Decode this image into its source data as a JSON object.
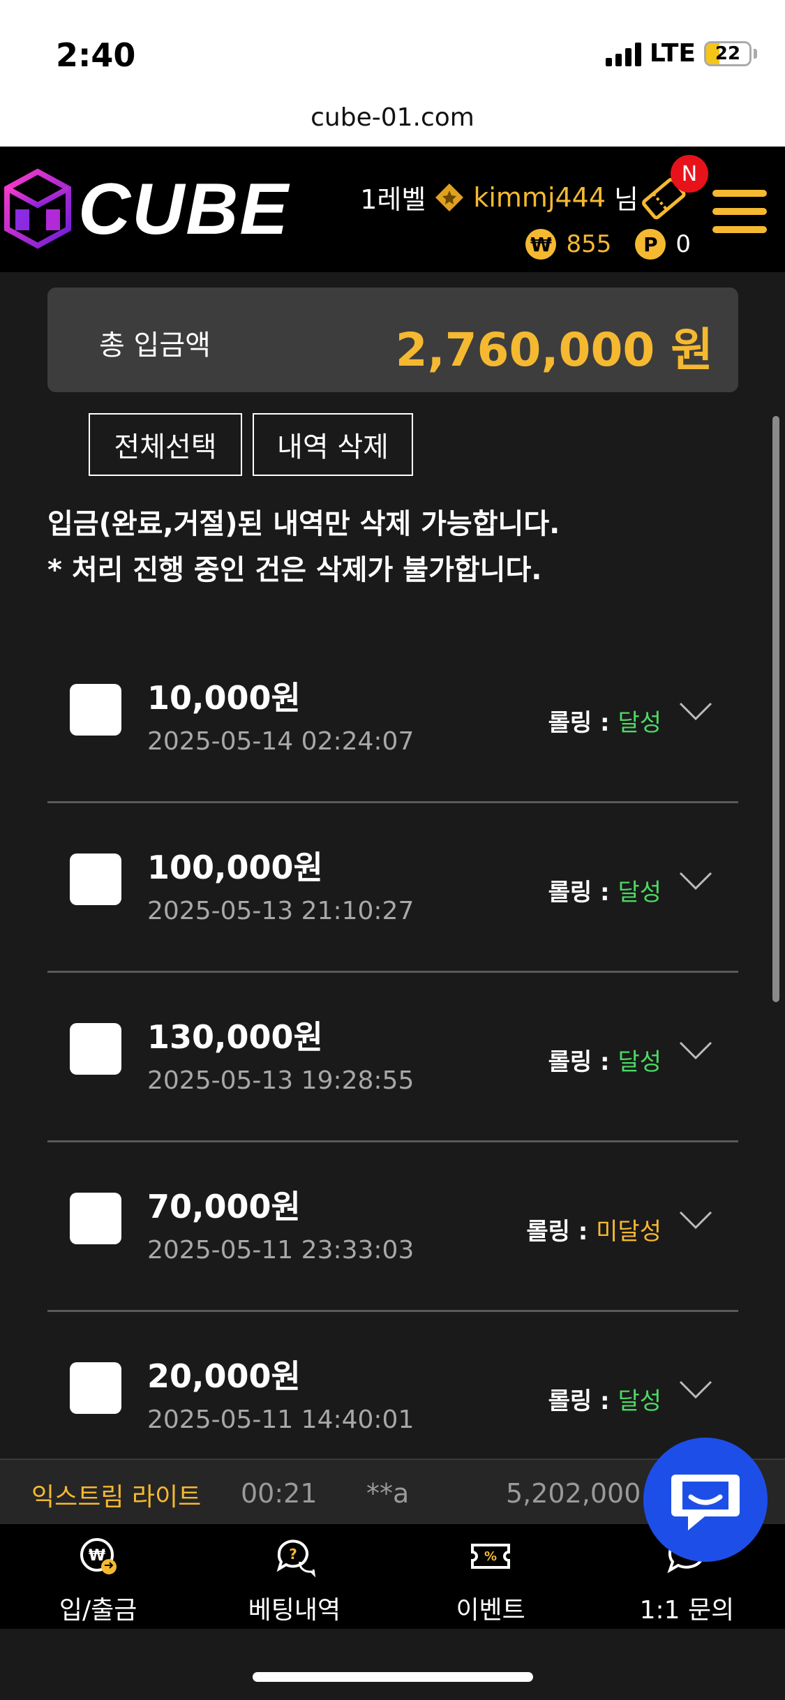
{
  "status_bar": {
    "time": "2:40",
    "network": "LTE",
    "battery": "22"
  },
  "browser": {
    "url": "cube-01.com"
  },
  "header": {
    "logo_text": "CUBE",
    "level": "1레벨",
    "username": "kimmj444",
    "honorific": "님",
    "notification_badge": "N",
    "money_symbol": "₩",
    "money": "855",
    "point_symbol": "P",
    "points": "0"
  },
  "summary": {
    "label": "총 입금액",
    "value": "2,760,000 원"
  },
  "actions": {
    "select_all": "전체선택",
    "delete": "내역 삭제"
  },
  "notice": {
    "line1": "입금(완료,거절)된 내역만 삭제 가능합니다.",
    "line2": "* 처리 진행 중인 건은 삭제가 불가합니다."
  },
  "rolling_label": "롤링 :",
  "deposits": [
    {
      "amount": "10,000원",
      "date": "2025-05-14 02:24:07",
      "status": "달성"
    },
    {
      "amount": "100,000원",
      "date": "2025-05-13 21:10:27",
      "status": "달성"
    },
    {
      "amount": "130,000원",
      "date": "2025-05-13 19:28:55",
      "status": "달성"
    },
    {
      "amount": "70,000원",
      "date": "2025-05-11 23:33:03",
      "status": "미달성"
    },
    {
      "amount": "20,000원",
      "date": "2025-05-11 14:40:01",
      "status": "달성"
    }
  ],
  "ticker": {
    "game": "익스트림 라이트",
    "time": "00:21",
    "user": "**a",
    "amount": "5,202,000"
  },
  "bottom_nav": [
    {
      "label": "입/출금",
      "icon": "wallet-exchange-icon"
    },
    {
      "label": "베팅내역",
      "icon": "question-chat-icon"
    },
    {
      "label": "이벤트",
      "icon": "coupon-icon"
    },
    {
      "label": "1:1 문의",
      "icon": "chat-icon"
    }
  ],
  "colors": {
    "accent": "#f5b931",
    "achieved": "#4cd964",
    "not_achieved": "#f5b931",
    "chat_button": "#1d4fe8",
    "badge": "#e8121a"
  }
}
